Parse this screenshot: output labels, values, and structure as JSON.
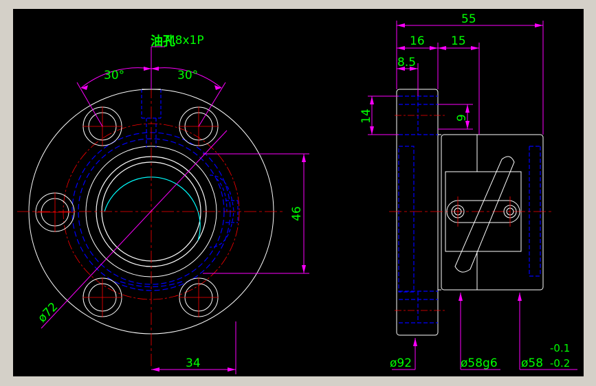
{
  "drawing": {
    "oil_hole_label": "油孔",
    "thread_label": "M8x1P",
    "angle_left": "30°",
    "angle_right": "30°",
    "dim_46": "46",
    "dim_34": "34",
    "dim_phi72": "ø72",
    "dim_55": "55",
    "dim_16": "16",
    "dim_15": "15",
    "dim_8_5": "8.5",
    "dim_14": "14",
    "dim_9": "9",
    "dim_phi92": "ø92",
    "dim_phi58g6": "ø58g6",
    "dim_phi58": "ø58",
    "tol_upper": "-0.1",
    "tol_lower": "-0.2"
  },
  "colors": {
    "background": "#000000",
    "frame": "#d4d0c8",
    "outline": "#ffffff",
    "center_line": "#ff0000",
    "hidden_line": "#0000ff",
    "dimension": "#ff00ff",
    "dim_text": "#00ff00",
    "thread": "#00ffff"
  }
}
